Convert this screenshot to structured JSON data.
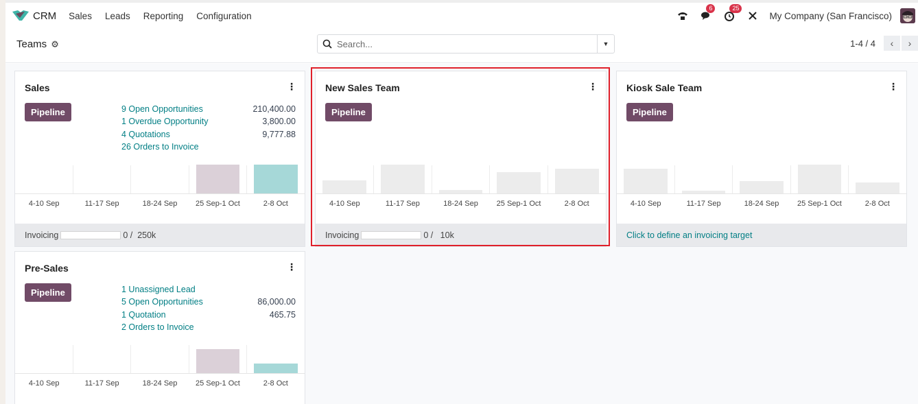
{
  "app": {
    "brand": "CRM",
    "menu": [
      "Sales",
      "Leads",
      "Reporting",
      "Configuration"
    ],
    "systray": {
      "phone_icon": "phone-icon",
      "messages_badge": "6",
      "activities_badge": "25",
      "tools_icon": "debug-tools-icon",
      "company": "My Company (San Francisco)"
    }
  },
  "control": {
    "title": "Teams",
    "search_placeholder": "Search...",
    "search_value": "",
    "pager": "1-4 / 4"
  },
  "colors": {
    "accent": "#714b67",
    "link": "#017e84",
    "bar_past": "#dbd0d8",
    "bar_current": "#a6d8d8",
    "bar_sample": "#ececec",
    "highlight": "#e0202a"
  },
  "teams": [
    {
      "name": "Sales",
      "pipeline_label": "Pipeline",
      "stats": [
        {
          "label": "9 Open Opportunities",
          "value": "210,400.00"
        },
        {
          "label": "1 Overdue Opportunity",
          "value": "3,800.00"
        },
        {
          "label": "4 Quotations",
          "value": "9,777.88"
        },
        {
          "label": "26 Orders to Invoice",
          "value": ""
        }
      ],
      "footer": {
        "type": "progress",
        "label": "Invoicing",
        "current": "0",
        "target": "250k",
        "fraction": 0
      }
    },
    {
      "name": "New Sales Team",
      "pipeline_label": "Pipeline",
      "stats": [],
      "footer": {
        "type": "progress",
        "label": "Invoicing",
        "current": "0",
        "target": "10k",
        "fraction": 0
      }
    },
    {
      "name": "Kiosk Sale Team",
      "pipeline_label": "Pipeline",
      "stats": [],
      "footer": {
        "type": "link",
        "label": "Click to define an invoicing target"
      }
    },
    {
      "name": "Pre-Sales",
      "pipeline_label": "Pipeline",
      "stats": [
        {
          "label": "1 Unassigned Lead",
          "value": ""
        },
        {
          "label": "5 Open Opportunities",
          "value": "86,000.00"
        },
        {
          "label": "1 Quotation",
          "value": "465.75"
        },
        {
          "label": "2 Orders to Invoice",
          "value": ""
        }
      ],
      "footer": null
    }
  ],
  "chart_data": [
    {
      "type": "bar",
      "title": "Sales",
      "categories": [
        "4-10 Sep",
        "11-17 Sep",
        "18-24 Sep",
        "25 Sep-1 Oct",
        "2-8 Oct"
      ],
      "values": [
        0,
        0,
        0,
        1.0,
        1.0
      ],
      "bar_kinds": [
        "past",
        "past",
        "past",
        "past",
        "current"
      ],
      "note": "relative heights, no y-axis shown"
    },
    {
      "type": "bar",
      "title": "New Sales Team",
      "categories": [
        "4-10 Sep",
        "11-17 Sep",
        "18-24 Sep",
        "25 Sep-1 Oct",
        "2-8 Oct"
      ],
      "values": [
        0.46,
        1.0,
        0.12,
        0.73,
        0.85
      ],
      "bar_kinds": [
        "sample",
        "sample",
        "sample",
        "sample",
        "sample"
      ],
      "note": "sample data (grey), relative heights"
    },
    {
      "type": "bar",
      "title": "Kiosk Sale Team",
      "categories": [
        "4-10 Sep",
        "11-17 Sep",
        "18-24 Sep",
        "25 Sep-1 Oct",
        "2-8 Oct"
      ],
      "values": [
        0.85,
        0.1,
        0.44,
        1.0,
        0.39
      ],
      "bar_kinds": [
        "sample",
        "sample",
        "sample",
        "sample",
        "sample"
      ],
      "note": "sample data (grey), relative heights"
    },
    {
      "type": "bar",
      "title": "Pre-Sales",
      "categories": [
        "4-10 Sep",
        "11-17 Sep",
        "18-24 Sep",
        "25 Sep-1 Oct",
        "2-8 Oct"
      ],
      "values": [
        0,
        0,
        0,
        0.83,
        0.34
      ],
      "bar_kinds": [
        "past",
        "past",
        "past",
        "past",
        "current"
      ],
      "note": "relative heights, no y-axis shown"
    }
  ]
}
